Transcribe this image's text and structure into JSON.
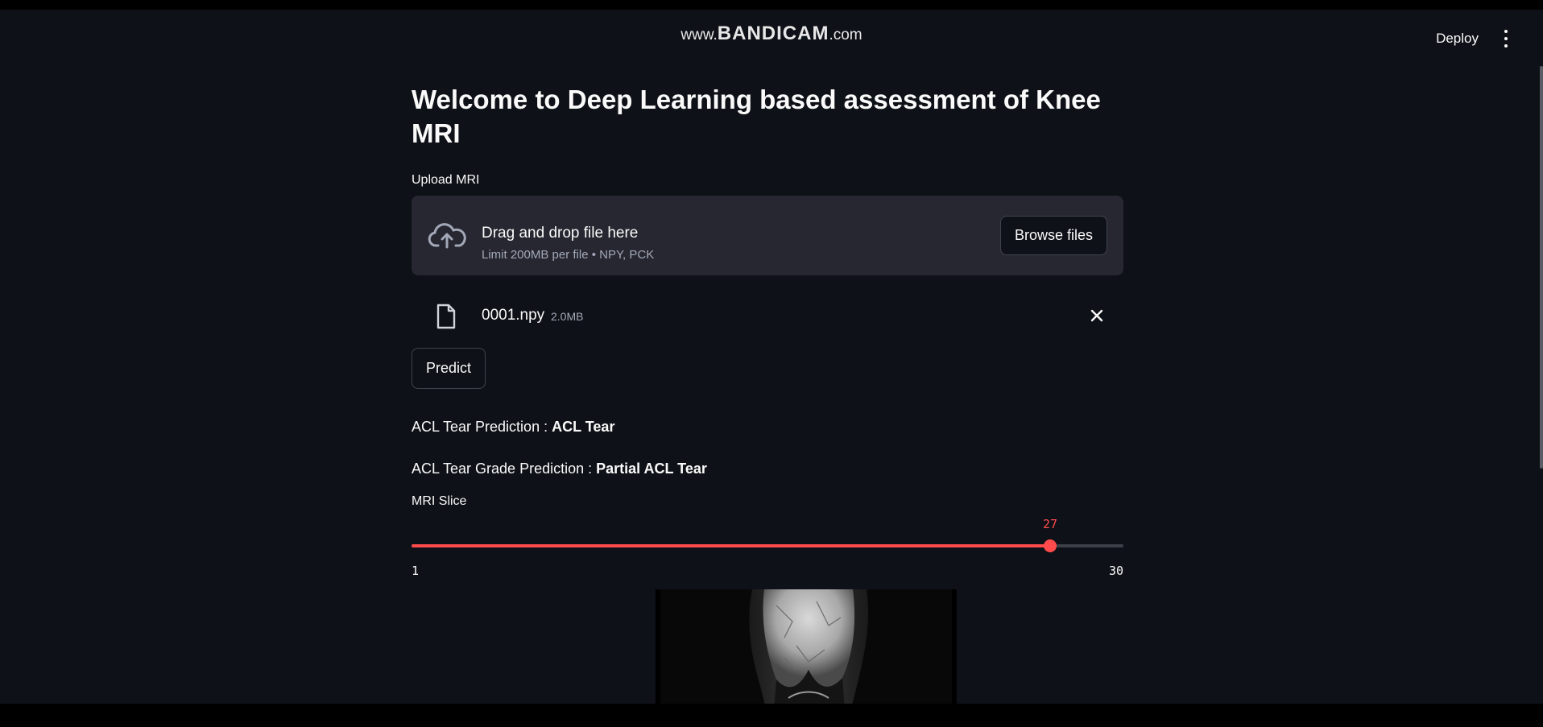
{
  "overlay": {
    "watermark_prefix": "www.",
    "watermark_brand": "BANDICAM",
    "watermark_suffix": ".com"
  },
  "header": {
    "deploy_label": "Deploy",
    "menu_icon": "vertical-ellipsis-icon"
  },
  "page": {
    "title": "Welcome to Deep Learning based assessment of Knee MRI"
  },
  "uploader": {
    "label": "Upload MRI",
    "icon": "cloud-upload-icon",
    "drag_text": "Drag and drop file here",
    "limit_text": "Limit 200MB per file • NPY, PCK",
    "browse_label": "Browse files"
  },
  "uploaded_file": {
    "icon": "file-icon",
    "name": "0001.npy",
    "size": "2.0MB",
    "remove_icon": "close-icon"
  },
  "actions": {
    "predict_label": "Predict"
  },
  "results": {
    "acl_tear_label": "ACL Tear Prediction : ",
    "acl_tear_value": "ACL Tear",
    "grade_label": "ACL Tear Grade Prediction : ",
    "grade_value": "Partial ACL Tear"
  },
  "slice_slider": {
    "label": "MRI Slice",
    "min": 1,
    "max": 30,
    "value": 27
  },
  "colors": {
    "background": "#0e1117",
    "panel": "#262730",
    "accent": "#ff4b4b",
    "text": "#fafafa",
    "muted_text": "#a3a8b8"
  }
}
